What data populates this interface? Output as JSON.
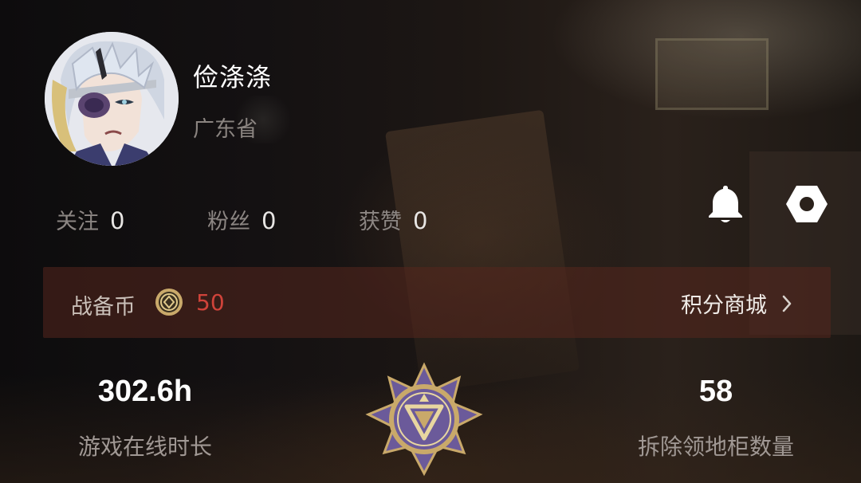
{
  "profile": {
    "username": "俭涤涤",
    "region": "广东省",
    "avatar_icon": "anime-character-avatar"
  },
  "stats": {
    "follow": {
      "label": "关注",
      "value": "0"
    },
    "fans": {
      "label": "粉丝",
      "value": "0"
    },
    "likes": {
      "label": "获赞",
      "value": "0"
    }
  },
  "actions": {
    "notification_icon": "bell-icon",
    "settings_icon": "hexagon-nut-settings-icon"
  },
  "coin_bar": {
    "label": "战备币",
    "coin_icon": "coin-icon",
    "amount": "50",
    "shop_label": "积分商城",
    "shop_arrow_icon": "chevron-right-icon"
  },
  "summary": {
    "online": {
      "value": "302.6h",
      "label": "游戏在线时长"
    },
    "removed": {
      "value": "58",
      "label": "拆除领地柜数量"
    },
    "rank_icon": "rank-badge-icon"
  },
  "colors": {
    "coin_amount": "#d0433a",
    "coin_bar_bg": "#56261e",
    "badge_purple": "#6b5a9a",
    "badge_gold": "#c9a96a"
  }
}
